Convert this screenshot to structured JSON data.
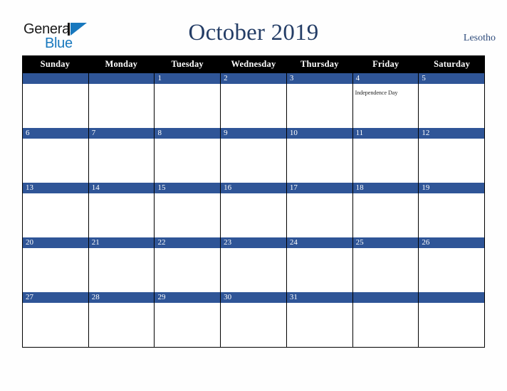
{
  "brand": {
    "name_part1": "General",
    "name_part2": "Blue",
    "mark_icon": "triangle-logo-icon",
    "accent_color": "#1878be"
  },
  "header": {
    "title": "October 2019",
    "country": "Lesotho",
    "title_color": "#243d66"
  },
  "calendar": {
    "month": "October",
    "year": "2019",
    "weekday_headers": [
      "Sunday",
      "Monday",
      "Tuesday",
      "Wednesday",
      "Thursday",
      "Friday",
      "Saturday"
    ],
    "header_bg": "#000000",
    "day_band_color": "#2f5597",
    "weeks": [
      [
        {
          "day": "",
          "event": ""
        },
        {
          "day": "",
          "event": ""
        },
        {
          "day": "1",
          "event": ""
        },
        {
          "day": "2",
          "event": ""
        },
        {
          "day": "3",
          "event": ""
        },
        {
          "day": "4",
          "event": "Independence Day"
        },
        {
          "day": "5",
          "event": ""
        }
      ],
      [
        {
          "day": "6",
          "event": ""
        },
        {
          "day": "7",
          "event": ""
        },
        {
          "day": "8",
          "event": ""
        },
        {
          "day": "9",
          "event": ""
        },
        {
          "day": "10",
          "event": ""
        },
        {
          "day": "11",
          "event": ""
        },
        {
          "day": "12",
          "event": ""
        }
      ],
      [
        {
          "day": "13",
          "event": ""
        },
        {
          "day": "14",
          "event": ""
        },
        {
          "day": "15",
          "event": ""
        },
        {
          "day": "16",
          "event": ""
        },
        {
          "day": "17",
          "event": ""
        },
        {
          "day": "18",
          "event": ""
        },
        {
          "day": "19",
          "event": ""
        }
      ],
      [
        {
          "day": "20",
          "event": ""
        },
        {
          "day": "21",
          "event": ""
        },
        {
          "day": "22",
          "event": ""
        },
        {
          "day": "23",
          "event": ""
        },
        {
          "day": "24",
          "event": ""
        },
        {
          "day": "25",
          "event": ""
        },
        {
          "day": "26",
          "event": ""
        }
      ],
      [
        {
          "day": "27",
          "event": ""
        },
        {
          "day": "28",
          "event": ""
        },
        {
          "day": "29",
          "event": ""
        },
        {
          "day": "30",
          "event": ""
        },
        {
          "day": "31",
          "event": ""
        },
        {
          "day": "",
          "event": ""
        },
        {
          "day": "",
          "event": ""
        }
      ]
    ]
  }
}
